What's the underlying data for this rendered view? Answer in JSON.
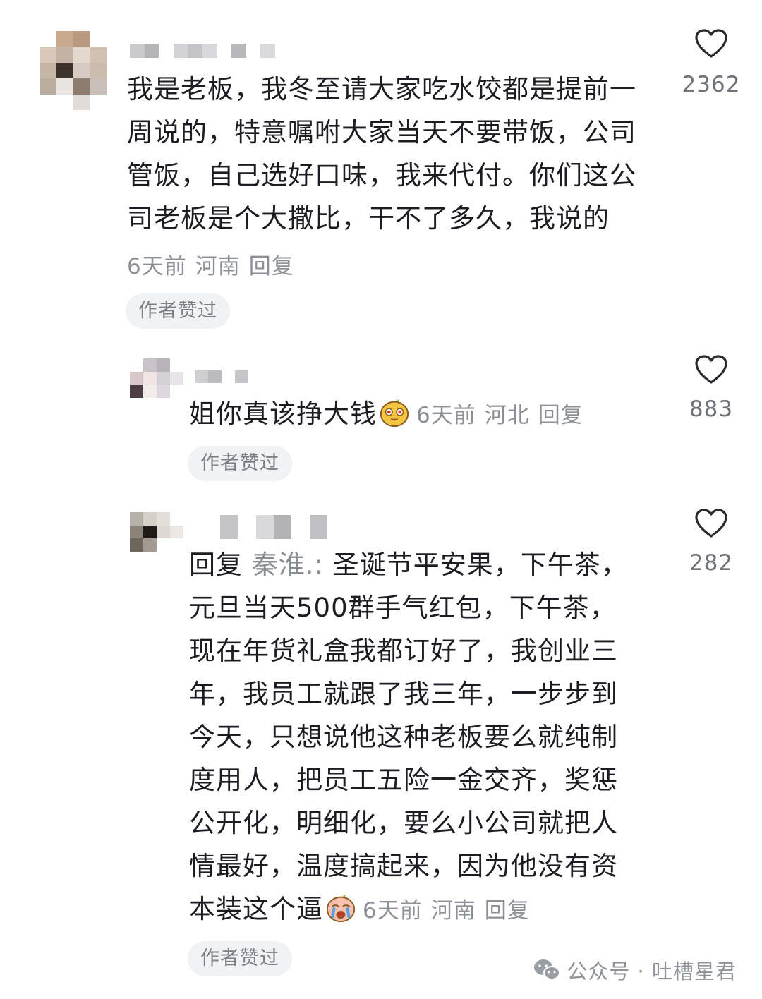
{
  "comments": [
    {
      "text": "我是老板，我冬至请大家吃水饺都是提前一周说的，特意嘱咐大家当天不要带饭，公司管饭，自己选好口味，我来代付。你们这公司老板是个大撒比，干不了多久，我说的",
      "time": "6天前",
      "location": "河南",
      "reply_label": "回复",
      "badge": "作者赞过",
      "likes": "2362"
    },
    {
      "text": "姐你真该挣大钱",
      "time": "6天前",
      "location": "河北",
      "reply_label": "回复",
      "badge": "作者赞过",
      "likes": "883",
      "emoji": "tearful-face-emoji"
    },
    {
      "reply_prefix": "回复",
      "mention": "秦淮.:",
      "text": "圣诞节平安果，下午茶，元旦当天500群手气红包，下午茶，现在年货礼盒我都订好了，我创业三年，我员工就跟了我三年，一步步到今天，只想说他这种老板要么就纯制度用人，把员工五险一金交齐，奖惩公开化，明细化，要么小公司就把人情最好，温度搞起来，因为他没有资本装这个逼",
      "time": "6天前",
      "location": "河南",
      "reply_label": "回复",
      "badge": "作者赞过",
      "likes": "282",
      "emoji": "crying-face-emoji"
    }
  ],
  "watermark": {
    "label": "公众号 · 吐槽星君",
    "icon": "wechat-icon"
  },
  "colors": {
    "text": "#1c1c22",
    "meta": "#8d9097",
    "badge_bg": "#f1f2f4",
    "mention": "#8a8d94"
  }
}
